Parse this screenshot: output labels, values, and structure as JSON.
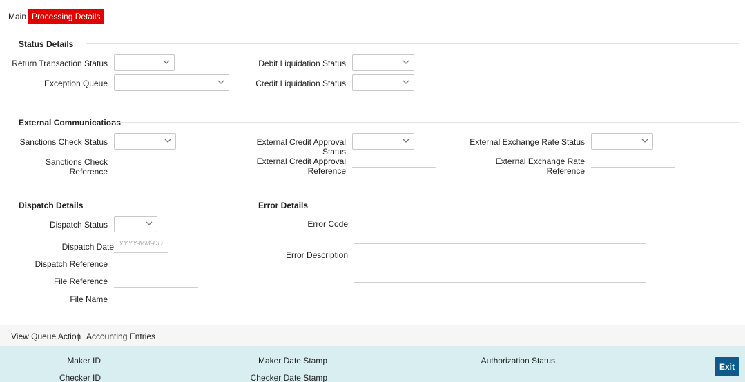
{
  "tabs": {
    "main": "Main",
    "processing": "Processing Details"
  },
  "status_details": {
    "title": "Status Details",
    "return_transaction_status": "Return Transaction Status",
    "exception_queue": "Exception Queue",
    "debit_liquidation_status": "Debit Liquidation Status",
    "credit_liquidation_status": "Credit Liquidation Status"
  },
  "external_comm": {
    "title": "External Communications",
    "sanctions_check_status": "Sanctions Check Status",
    "sanctions_check_reference": "Sanctions Check Reference",
    "ext_credit_approval_status": "External Credit Approval Status",
    "ext_credit_approval_ref_1": "External Credit Approval",
    "ext_credit_approval_ref_2": "Reference",
    "ext_exchange_rate_status": "External Exchange Rate Status",
    "ext_exchange_rate_ref_1": "External Exchange Rate",
    "ext_exchange_rate_ref_2": "Reference"
  },
  "dispatch": {
    "title": "Dispatch Details",
    "dispatch_status": "Dispatch Status",
    "dispatch_date": "Dispatch Date",
    "dispatch_date_placeholder": "YYYY-MM-DD",
    "dispatch_reference": "Dispatch Reference",
    "file_reference": "File Reference",
    "file_name": "File Name"
  },
  "error": {
    "title": "Error Details",
    "error_code": "Error Code",
    "error_description": "Error Description"
  },
  "footer_links": {
    "view_queue_action": "View Queue Action",
    "separator": "|",
    "accounting_entries": "Accounting Entries"
  },
  "audit": {
    "maker_id": "Maker ID",
    "checker_id": "Checker ID",
    "maker_date_stamp": "Maker Date Stamp",
    "checker_date_stamp": "Checker Date Stamp",
    "authorization_status": "Authorization Status",
    "exit": "Exit"
  }
}
